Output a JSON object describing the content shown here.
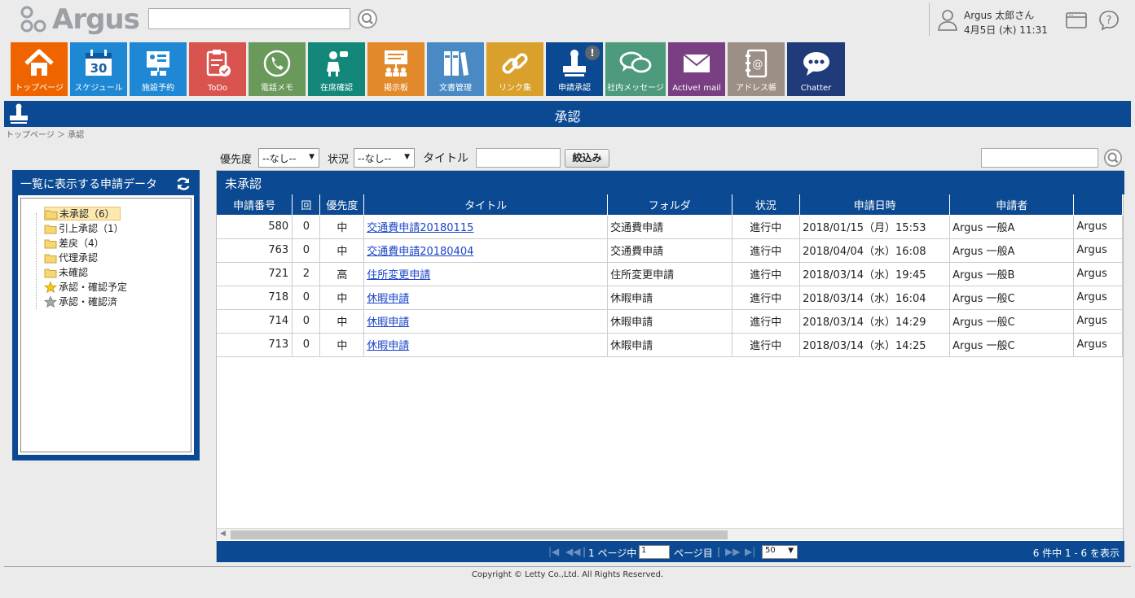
{
  "header": {
    "logo_text": "Argus",
    "user_name": "Argus 太郎さん",
    "user_datetime": "4月5日 (木) 11:31"
  },
  "apps": [
    {
      "label": "トップページ",
      "icon": "home-icon",
      "color": "#f06400"
    },
    {
      "label": "スケジュール",
      "icon": "calendar-icon",
      "color": "#1e88d4",
      "icon_text": "30"
    },
    {
      "label": "施設予約",
      "icon": "facility-icon",
      "color": "#1e88d4"
    },
    {
      "label": "ToDo",
      "icon": "todo-icon",
      "color": "#d9534f"
    },
    {
      "label": "電話メモ",
      "icon": "phone-icon",
      "color": "#6a9a5b"
    },
    {
      "label": "在席確認",
      "icon": "presence-icon",
      "color": "#12877a"
    },
    {
      "label": "掲示板",
      "icon": "board-icon",
      "color": "#e28a2b"
    },
    {
      "label": "文書管理",
      "icon": "document-icon",
      "color": "#4a8ac4"
    },
    {
      "label": "リンク集",
      "icon": "link-icon",
      "color": "#d9a02b"
    },
    {
      "label": "申請承認",
      "icon": "stamp-icon",
      "color": "#0b4a92",
      "badge": "!"
    },
    {
      "label": "社内メッセージ",
      "icon": "message-icon",
      "color": "#4e9a7c"
    },
    {
      "label": "Active! mail",
      "icon": "mail-icon",
      "color": "#7a3f83"
    },
    {
      "label": "アドレス帳",
      "icon": "addressbook-icon",
      "color": "#9b8f86"
    },
    {
      "label": "Chatter",
      "icon": "chatter-icon",
      "color": "#1f3b7a"
    }
  ],
  "page": {
    "title": "承認",
    "breadcrumb": "トップページ ＞ 承認"
  },
  "filter": {
    "priority_label": "優先度",
    "priority_value": "--なし--",
    "status_label": "状況",
    "status_value": "--なし--",
    "title_label": "タイトル",
    "title_value": "",
    "narrow_button": "絞込み"
  },
  "left_panel": {
    "title": "一覧に表示する申請データ",
    "items": [
      {
        "label": "未承認（6）",
        "icon": "folder-icon"
      },
      {
        "label": "引上承認（1）",
        "icon": "folder-icon"
      },
      {
        "label": "差戻（4）",
        "icon": "folder-icon"
      },
      {
        "label": "代理承認",
        "icon": "folder-icon"
      },
      {
        "label": "未確認",
        "icon": "folder-icon"
      },
      {
        "label": "承認・確認予定",
        "icon": "star-icon"
      },
      {
        "label": "承認・確認済",
        "icon": "star-gray-icon"
      }
    ]
  },
  "grid": {
    "title": "未承認",
    "columns": [
      "申請番号",
      "回",
      "優先度",
      "タイトル",
      "フォルダ",
      "状況",
      "申請日時",
      "申請者",
      ""
    ],
    "rows": [
      [
        "580",
        "0",
        "中",
        "交通費申請20180115",
        "交通費申請",
        "進行中",
        "2018/01/15（月）15:53",
        "Argus 一般A",
        "Argus"
      ],
      [
        "763",
        "0",
        "中",
        "交通費申請20180404",
        "交通費申請",
        "進行中",
        "2018/04/04（水）16:08",
        "Argus 一般A",
        "Argus"
      ],
      [
        "721",
        "2",
        "高",
        "住所変更申請",
        "住所変更申請",
        "進行中",
        "2018/03/14（水）19:45",
        "Argus 一般B",
        "Argus"
      ],
      [
        "718",
        "0",
        "中",
        "休暇申請",
        "休暇申請",
        "進行中",
        "2018/03/14（水）16:04",
        "Argus 一般C",
        "Argus"
      ],
      [
        "714",
        "0",
        "中",
        "休暇申請",
        "休暇申請",
        "進行中",
        "2018/03/14（水）14:29",
        "Argus 一般C",
        "Argus"
      ],
      [
        "713",
        "0",
        "中",
        "休暇申請",
        "休暇申請",
        "進行中",
        "2018/03/14（水）14:25",
        "Argus 一般C",
        "Argus"
      ]
    ]
  },
  "pager": {
    "page_prefix": "1 ページ中",
    "page_value": "1",
    "page_suffix": "ページ目",
    "per_page": "50",
    "count_text": "6 件中 1 - 6 を表示"
  },
  "footer": {
    "copyright": "Copyright © Letty Co.,Ltd. All Rights Reserved."
  }
}
